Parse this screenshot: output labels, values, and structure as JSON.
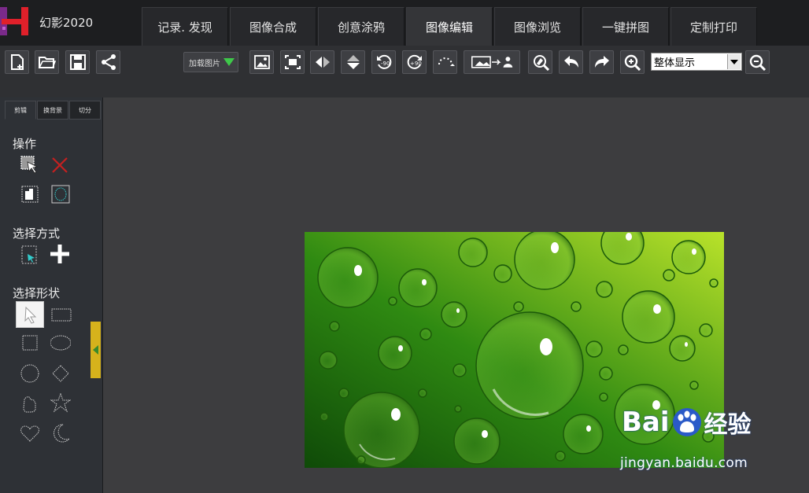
{
  "app": {
    "title": "幻影2020"
  },
  "tabs": [
    {
      "label": "记录. 发现"
    },
    {
      "label": "图像合成"
    },
    {
      "label": "创意涂鸦"
    },
    {
      "label": "图像编辑",
      "active": true
    },
    {
      "label": "图像浏览"
    },
    {
      "label": "一键拼图"
    },
    {
      "label": "定制打印"
    }
  ],
  "toolbar": {
    "load_label": "加载图片",
    "zoom_value": "整体显示",
    "icons": [
      "new-file-icon",
      "open-folder-icon",
      "save-icon",
      "share-icon",
      "fit-image-icon",
      "crop-icon",
      "flip-horizontal-icon",
      "flip-vertical-icon",
      "rotate-left-90-icon",
      "rotate-right-90-icon",
      "rotate-free-icon",
      "perspective-icon",
      "eraser-icon",
      "undo-icon",
      "redo-icon",
      "zoom-in-icon",
      "zoom-out-icon"
    ]
  },
  "left_panel": {
    "tabs": [
      {
        "label": "剪辑"
      },
      {
        "label": "换背景"
      },
      {
        "label": "切分"
      }
    ],
    "section_operation": "操作",
    "section_select_mode": "选择方式",
    "section_select_shape": "选择形状"
  },
  "watermark": {
    "brand_a": "Bai",
    "brand_b": "经验",
    "url": "jingyan.baidu.com"
  },
  "colors": {
    "accent_green": "#3ec84a",
    "handle_yellow": "#d6b21c",
    "logo_red": "#e0202a",
    "logo_purple": "#7a2a8a"
  }
}
